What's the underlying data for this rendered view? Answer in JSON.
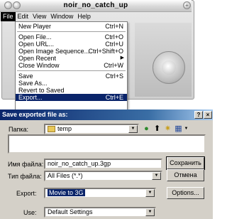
{
  "player": {
    "title": "noir_no_catch_up",
    "zoom_glyph": "+",
    "menubar": [
      "File",
      "Edit",
      "View",
      "Window",
      "Help"
    ]
  },
  "file_menu": {
    "items": [
      {
        "label": "New Player",
        "shortcut": "Ctrl+N"
      },
      {
        "label": "Open File...",
        "shortcut": "Ctrl+O"
      },
      {
        "label": "Open URL...",
        "shortcut": "Ctrl+U"
      },
      {
        "label": "Open Image Sequence...",
        "shortcut": "Ctrl+Shift+O"
      },
      {
        "label": "Open Recent",
        "shortcut": ""
      },
      {
        "label": "Close Window",
        "shortcut": "Ctrl+W"
      },
      {
        "label": "Save",
        "shortcut": "Ctrl+S"
      },
      {
        "label": "Save As...",
        "shortcut": ""
      },
      {
        "label": "Revert to Saved",
        "shortcut": ""
      },
      {
        "label": "Export...",
        "shortcut": "Ctrl+E"
      }
    ]
  },
  "dialog": {
    "title": "Save exported file as:",
    "help_glyph": "?",
    "close_glyph": "×",
    "folder_label": "Папка:",
    "folder_value": "temp",
    "filename_label": "Имя файла:",
    "filename_value": "noir_no_catch_up.3gp",
    "filetype_label": "Тип файла:",
    "filetype_value": "All Files (*.*)",
    "save_button": "Сохранить",
    "cancel_button": "Отмена",
    "export_label": "Export:",
    "export_value": "Movie to 3G",
    "options_button": "Options...",
    "use_label": "Use:",
    "use_value": "Default Settings"
  },
  "colors": {
    "selection": "#0a246a",
    "dialog_face": "#d4d0c8"
  }
}
